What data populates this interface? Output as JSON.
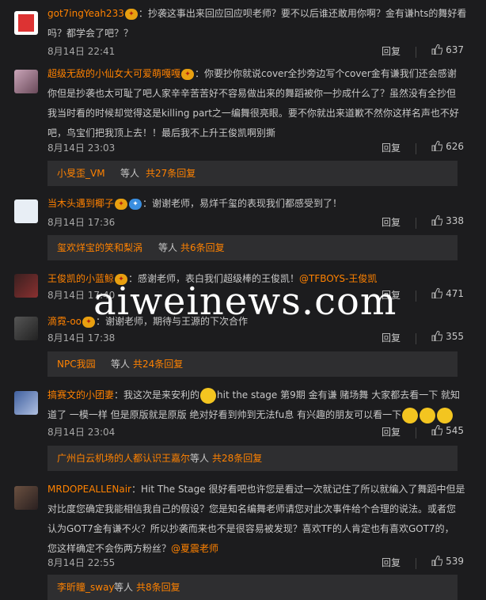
{
  "comments": [
    {
      "user": "got7ingYeah233",
      "text_lines": [
        "：抄袭这事出来回应回应呗老师？要不以后谁还敢用你啊？金有谦hts的舞好看",
        "吗？都学会了吧？？"
      ],
      "date": "8月14日 22:41",
      "reply": "回复",
      "likes": "637"
    },
    {
      "user": "超级无敌的小仙女大可爱萌嘎嘎",
      "text_lines": [
        "：你要抄你就说cover全抄旁边写个cover金有谦我们还会感谢",
        "你但是抄袭也太可耻了吧人家辛辛苦苦好不容易做出来的舞蹈被你一抄成什么了？虽然没有全抄但",
        "我当时看的时候却觉得这是killing part之一编舞很亮眼。要不你就出来道歉不然你这样名声也不好",
        "吧，鸟宝们把我顶上去！！最后我不上升王俊凯啊别撕"
      ],
      "date": "8月14日 23:03",
      "reply": "回复",
      "likes": "626",
      "sub": {
        "names": "小旻歪_VM",
        "etc": "等人",
        "count": "共27条回复"
      }
    },
    {
      "user": "当木头遇到椰子",
      "text_lines": [
        "：谢谢老师，易烊千玺的表现我们都感受到了！"
      ],
      "date": "8月14日 17:36",
      "reply": "回复",
      "likes": "338",
      "sub": {
        "names": "玺欢烊宝的笑和梨涡",
        "etc": "等人",
        "count": "共6条回复"
      }
    },
    {
      "user": "王俊凯的小蓝鲸",
      "text_lines": [
        "：感谢老师，表白我们超级棒的王俊凯！",
        "@TFBOYS-王俊凯"
      ],
      "date": "8月14日 17:40",
      "reply": "回复",
      "likes": "471"
    },
    {
      "user": "滴霓-oo",
      "text_lines": [
        "：谢谢老师，期待与王源的下次合作"
      ],
      "date": "8月14日 17:38",
      "reply": "回复",
      "likes": "355",
      "sub": {
        "names": "NPC我园",
        "etc": "等人",
        "count": "共24条回复"
      }
    },
    {
      "user": "搞赛文的小团妻",
      "text_lines": [
        "：我这次是来安利的",
        "hit the stage 第9期 金有谦 赌场舞 大家都去看一下 就知",
        "道了 一模一样 但是原版就是原版 绝对好看到帅到无法fu息 有兴趣的朋友可以看一下"
      ],
      "date": "8月14日 23:04",
      "reply": "回复",
      "likes": "545",
      "sub": {
        "names": "广州白云机场的人都认识王嘉尔",
        "etc": "等人",
        "count": "共28条回复"
      }
    },
    {
      "user": "MRDOPEALLENair",
      "text_lines": [
        "：Hit The Stage 很好看吧也许您是看过一次就记住了所以就编入了舞蹈中但是",
        "对比度您确定我能相信我自己的假设？您是知名编舞老师请您对此次事件给个合理的说法。或者您",
        "认为GOT7金有谦不火？所以抄袭而来也不是很容易被发现？喜欢TF的人肯定也有喜欢GOT7的，",
        "您这样确定不会伤两方粉丝？",
        "@夏震老师"
      ],
      "date": "8月14日 22:55",
      "reply": "回复",
      "likes": "539",
      "sub": {
        "names": "李昕瞳_sway",
        "etc": "等人",
        "count": "共8条回复"
      }
    }
  ],
  "watermark": "aiweinews.com",
  "icons": {
    "tag": "vip-badge-icon",
    "like": "thumb-up-icon",
    "emoji": "smile-emoji-icon"
  }
}
